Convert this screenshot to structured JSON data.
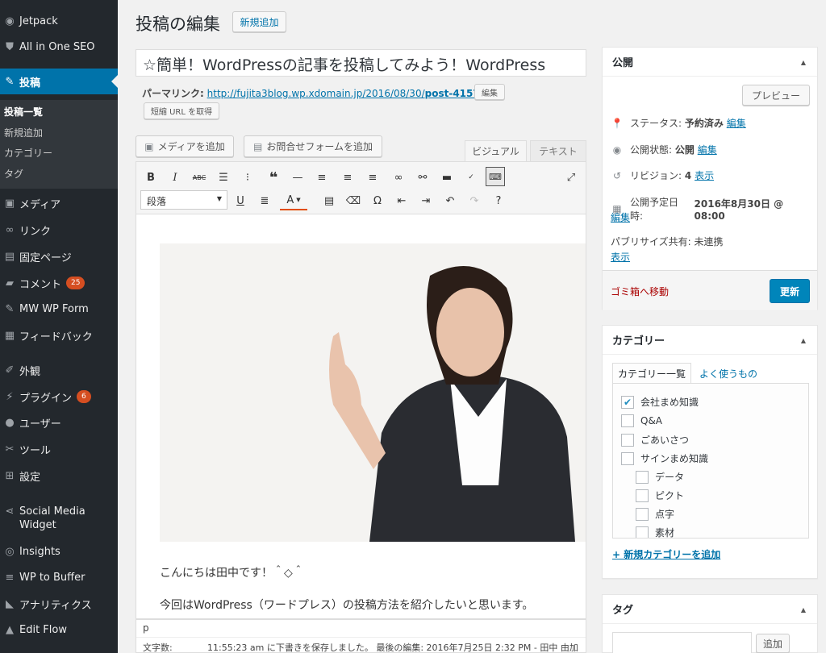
{
  "sidebar": {
    "items": [
      {
        "icon": "jetpack-icon",
        "label": "Jetpack"
      },
      {
        "icon": "shield-icon",
        "label": "All in One SEO"
      },
      {
        "icon": "pin-icon",
        "label": "投稿"
      },
      {
        "icon": "media-icon",
        "label": "メディア"
      },
      {
        "icon": "link-icon",
        "label": "リンク"
      },
      {
        "icon": "page-icon",
        "label": "固定ページ"
      },
      {
        "icon": "comment-icon",
        "label": "コメント",
        "badge": "25"
      },
      {
        "icon": "pin-icon",
        "label": "MW WP Form"
      },
      {
        "icon": "feedback-icon",
        "label": "フィードバック"
      },
      {
        "icon": "brush-icon",
        "label": "外観"
      },
      {
        "icon": "plugin-icon",
        "label": "プラグイン",
        "badge": "6"
      },
      {
        "icon": "user-icon",
        "label": "ユーザー"
      },
      {
        "icon": "wrench-icon",
        "label": "ツール"
      },
      {
        "icon": "settings-icon",
        "label": "設定"
      },
      {
        "icon": "share-icon",
        "label": "Social Media Widget"
      },
      {
        "icon": "insights-icon",
        "label": "Insights"
      },
      {
        "icon": "buffer-icon",
        "label": "WP to Buffer"
      },
      {
        "icon": "chart-icon",
        "label": "アナリティクス"
      },
      {
        "icon": "editflow-icon",
        "label": "Edit Flow"
      }
    ],
    "submenu": [
      "投稿一覧",
      "新規追加",
      "カテゴリー",
      "タグ"
    ]
  },
  "header": {
    "title": "投稿の編集",
    "add_new": "新規追加"
  },
  "post": {
    "title": "☆簡単！WordPressの記事を投稿してみよう！WordPress",
    "permalink_label": "パーマリンク:",
    "permalink_prefix": "http://fujita3blog.wp.xdomain.jp/2016/08/30/",
    "permalink_slug": "post-4157",
    "permalink_suffix": "/",
    "edit_label": "編集",
    "shortlink_label": "短縮 URL を取得"
  },
  "editor": {
    "add_media": "メディアを追加",
    "add_form": "お問合せフォームを追加",
    "tab_visual": "ビジュアル",
    "tab_text": "テキスト",
    "format_select": "段落",
    "para1": "こんにちは田中です！＾◇＾",
    "para2": "今回はWordPress（ワードプレス）の投稿方法を紹介したいと思います。",
    "path": "p",
    "word_count_label": "文字数:",
    "status": "11:55:23 am に下書きを保存しました。 最後の編集: 2016年7月25日 2:32 PM - 田中 由加"
  },
  "publish": {
    "title": "公開",
    "preview": "プレビュー",
    "status_label": "ステータス:",
    "status_value": "予約済み",
    "visibility_label": "公開状態:",
    "visibility_value": "公開",
    "revisions_label": "リビジョン:",
    "revisions_value": "4",
    "show": "表示",
    "edit": "編集",
    "schedule_label": "公開予定日時:",
    "schedule_value": "2016年8月30日 @ 08:00",
    "publicize_label": "パブリサイズ共有:",
    "publicize_value": "未連携",
    "trash": "ゴミ箱へ移動",
    "update": "更新"
  },
  "categories": {
    "title": "カテゴリー",
    "tab_all": "カテゴリー一覧",
    "tab_popular": "よく使うもの",
    "items": [
      {
        "label": "会社まめ知識",
        "checked": true
      },
      {
        "label": "Q&A",
        "checked": false
      },
      {
        "label": "ごあいさつ",
        "checked": false
      },
      {
        "label": "サインまめ知識",
        "checked": false
      },
      {
        "label": "データ",
        "checked": false
      },
      {
        "label": "ピクト",
        "checked": false
      },
      {
        "label": "点字",
        "checked": false
      },
      {
        "label": "素材",
        "checked": false
      }
    ],
    "add_new": "+ 新規カテゴリーを追加"
  },
  "tags": {
    "title": "タグ",
    "add": "追加"
  },
  "colors": {
    "sidebar": "#23282d",
    "accent": "#0073aa",
    "badge": "#d54e21",
    "trash": "#a00"
  }
}
